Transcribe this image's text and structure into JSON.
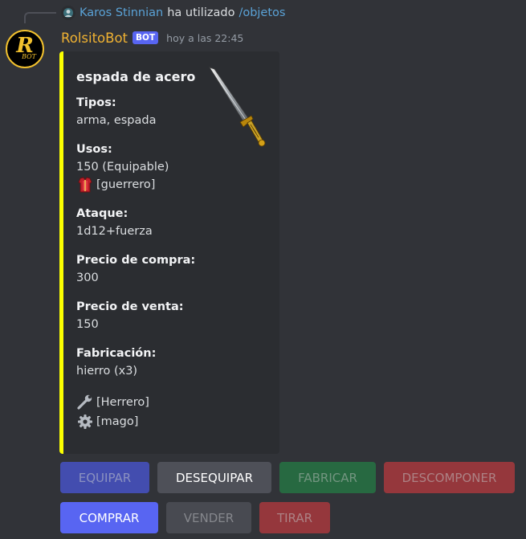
{
  "reply": {
    "user": "Karos Stinnian",
    "text": "ha utilizado",
    "command": "/objetos",
    "avatar_icon": "user-avatar-icon"
  },
  "message": {
    "author": "RolsitoBot",
    "badge": "BOT",
    "timestamp": "hoy a las 22:45",
    "avatar_letter": "R",
    "avatar_sub": "BOT"
  },
  "embed": {
    "accent_color": "#fbff00",
    "title": "espada de acero",
    "thumbnail": "sword-icon",
    "fields": {
      "tipos": {
        "name": "Tipos:",
        "value": "arma, espada"
      },
      "usos": {
        "name": "Usos:",
        "value": "150 (Equipable)",
        "extra": "[guerrero]"
      },
      "ataque": {
        "name": "Ataque:",
        "value": "1d12+fuerza"
      },
      "compra": {
        "name": "Precio de compra:",
        "value": "300"
      },
      "venta": {
        "name": "Precio de venta:",
        "value": "150"
      },
      "fabricacion": {
        "name": "Fabricación:",
        "value": "hierro (x3)"
      }
    },
    "footer": {
      "herrero": "[Herrero]",
      "mago": "[mago]"
    }
  },
  "buttons": {
    "equipar": "EQUIPAR",
    "desequipar": "DESEQUIPAR",
    "fabricar": "FABRICAR",
    "descomponer": "DESCOMPONER",
    "comprar": "COMPRAR",
    "vender": "VENDER",
    "tirar": "TIRAR"
  },
  "colors": {
    "background": "#313338",
    "embed_bg": "#2b2d31",
    "bot_name": "#f0b232",
    "link": "#5aa2d6",
    "blurple": "#5865f2"
  }
}
